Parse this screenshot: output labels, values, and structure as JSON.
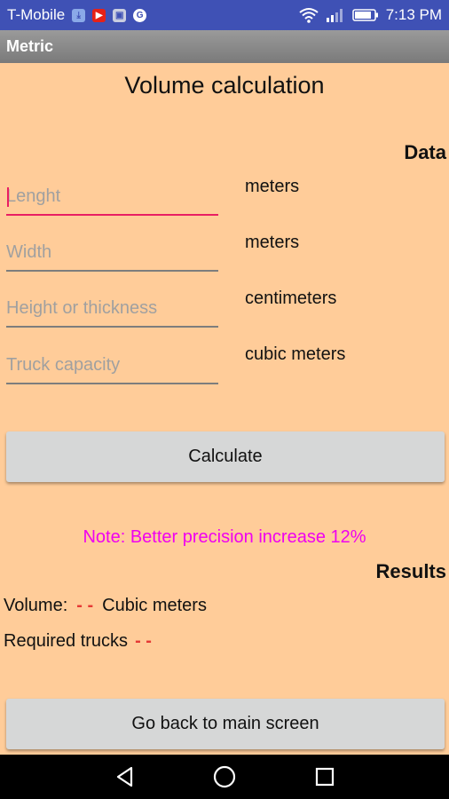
{
  "status_bar": {
    "carrier": "T-Mobile",
    "time": "7:13 PM",
    "icons": [
      "download-notification-icon",
      "youtube-icon",
      "image-icon",
      "google-icon",
      "wifi-icon",
      "signal-icon",
      "battery-icon"
    ]
  },
  "app_bar": {
    "title": "Metric"
  },
  "main": {
    "title": "Volume calculation",
    "data_label": "Data",
    "fields": [
      {
        "placeholder": "Lenght",
        "value": "",
        "unit": "meters"
      },
      {
        "placeholder": "Width",
        "value": "",
        "unit": "meters"
      },
      {
        "placeholder": "Height or thickness",
        "value": "",
        "unit": "centimeters"
      },
      {
        "placeholder": "Truck capacity",
        "value": "",
        "unit": "cubic meters"
      }
    ],
    "calculate_label": "Calculate",
    "note": "Note: Better precision increase 12%",
    "results_label": "Results",
    "volume_label": "Volume:",
    "volume_value": "- -",
    "volume_unit": "Cubic meters",
    "trucks_label": "Required trucks",
    "trucks_value": "- -",
    "back_label": "Go back to main screen"
  },
  "colors": {
    "status_bar": "#3F51B5",
    "background": "#FFCC99",
    "accent": "#E91E63",
    "note": "#F000F0",
    "result_dash": "#E53935"
  }
}
